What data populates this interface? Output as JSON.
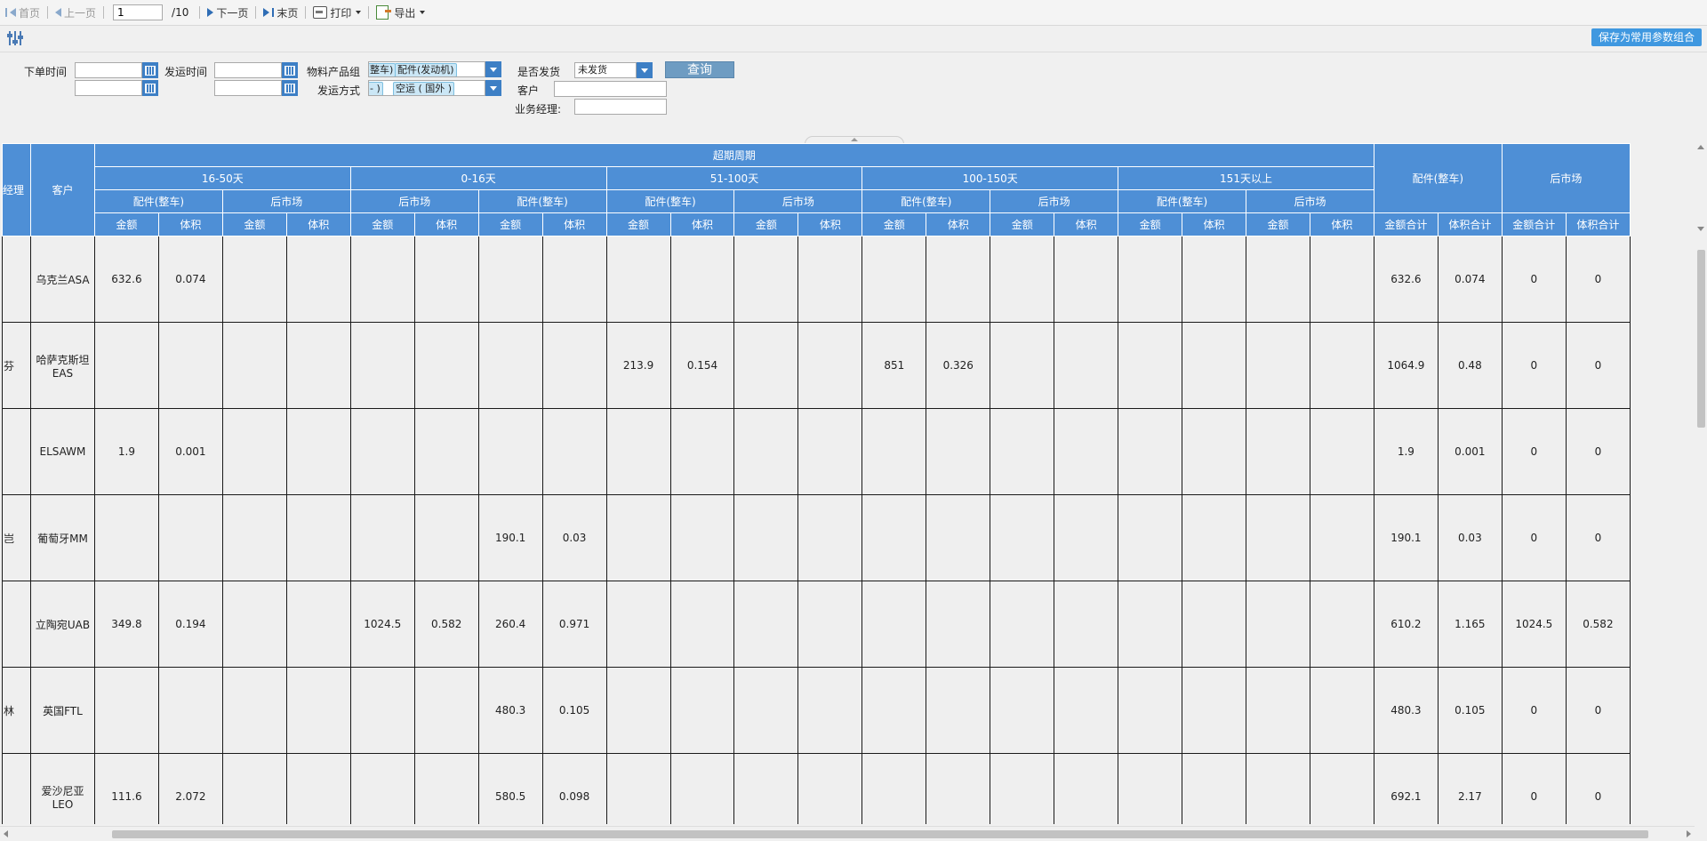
{
  "toolbar": {
    "first": "首页",
    "prev": "上一页",
    "page_value": "1",
    "page_total": "/10",
    "next": "下一页",
    "last": "末页",
    "print": "打印",
    "export": "导出"
  },
  "params": {
    "save_label": "保存为常用参数组合"
  },
  "form": {
    "order_time_label": "下单时间",
    "ship_time_label": "发运时间",
    "product_group_label": "物料产品组",
    "product_group_chip1": "整车)",
    "product_group_chip2": "配件(发动机)",
    "ship_method_label": "发运方式",
    "ship_method_chip1": "- )",
    "ship_method_chip2": "空运 ( 国外 )",
    "shipped_label": "是否发货",
    "shipped_value": "未发货",
    "customer_label": "客户",
    "manager_label": "业务经理:",
    "query_label": "查询"
  },
  "grid": {
    "header": {
      "manager": "经理",
      "customer": "客户",
      "overdue": "超期周期",
      "periods": [
        "16-50天",
        "0-16天",
        "51-100天",
        "100-150天",
        "151天以上"
      ],
      "period_subs": [
        [
          "配件(整车)",
          "后市场"
        ],
        [
          "后市场",
          "配件(整车)"
        ],
        [
          "配件(整车)",
          "后市场"
        ],
        [
          "配件(整车)",
          "后市场"
        ],
        [
          "配件(整车)",
          "后市场"
        ]
      ],
      "amount": "金额",
      "volume": "体积",
      "total_parts": "配件(整车)",
      "total_after": "后市场",
      "amount_total": "金额合计",
      "volume_total": "体积合计"
    },
    "rows": [
      {
        "mgr": "",
        "customer": "乌克兰ASA",
        "cells": [
          "632.6",
          "0.074",
          "",
          "",
          "",
          "",
          "",
          "",
          "",
          "",
          "",
          "",
          "",
          "",
          "",
          "",
          "",
          "",
          "",
          "",
          "632.6",
          "0.074",
          "0",
          "0"
        ]
      },
      {
        "mgr": "芬",
        "customer": "哈萨克斯坦EAS",
        "cells": [
          "",
          "",
          "",
          "",
          "",
          "",
          "",
          "",
          "213.9",
          "0.154",
          "",
          "",
          "851",
          "0.326",
          "",
          "",
          "",
          "",
          "",
          "",
          "1064.9",
          "0.48",
          "0",
          "0"
        ]
      },
      {
        "mgr": "",
        "customer": "ELSAWM",
        "cells": [
          "1.9",
          "0.001",
          "",
          "",
          "",
          "",
          "",
          "",
          "",
          "",
          "",
          "",
          "",
          "",
          "",
          "",
          "",
          "",
          "",
          "",
          "1.9",
          "0.001",
          "0",
          "0"
        ]
      },
      {
        "mgr": "岂",
        "customer": "葡萄牙MM",
        "cells": [
          "",
          "",
          "",
          "",
          "",
          "",
          "190.1",
          "0.03",
          "",
          "",
          "",
          "",
          "",
          "",
          "",
          "",
          "",
          "",
          "",
          "",
          "190.1",
          "0.03",
          "0",
          "0"
        ]
      },
      {
        "mgr": "",
        "customer": "立陶宛UAB",
        "cells": [
          "349.8",
          "0.194",
          "",
          "",
          "1024.5",
          "0.582",
          "260.4",
          "0.971",
          "",
          "",
          "",
          "",
          "",
          "",
          "",
          "",
          "",
          "",
          "",
          "",
          "610.2",
          "1.165",
          "1024.5",
          "0.582"
        ]
      },
      {
        "mgr": "林",
        "customer": "英国FTL",
        "cells": [
          "",
          "",
          "",
          "",
          "",
          "",
          "480.3",
          "0.105",
          "",
          "",
          "",
          "",
          "",
          "",
          "",
          "",
          "",
          "",
          "",
          "",
          "480.3",
          "0.105",
          "0",
          "0"
        ]
      },
      {
        "mgr": "",
        "customer": "爱沙尼亚LEO",
        "cells": [
          "111.6",
          "2.072",
          "",
          "",
          "",
          "",
          "580.5",
          "0.098",
          "",
          "",
          "",
          "",
          "",
          "",
          "",
          "",
          "",
          "",
          "",
          "",
          "692.1",
          "2.17",
          "0",
          "0"
        ]
      }
    ]
  }
}
